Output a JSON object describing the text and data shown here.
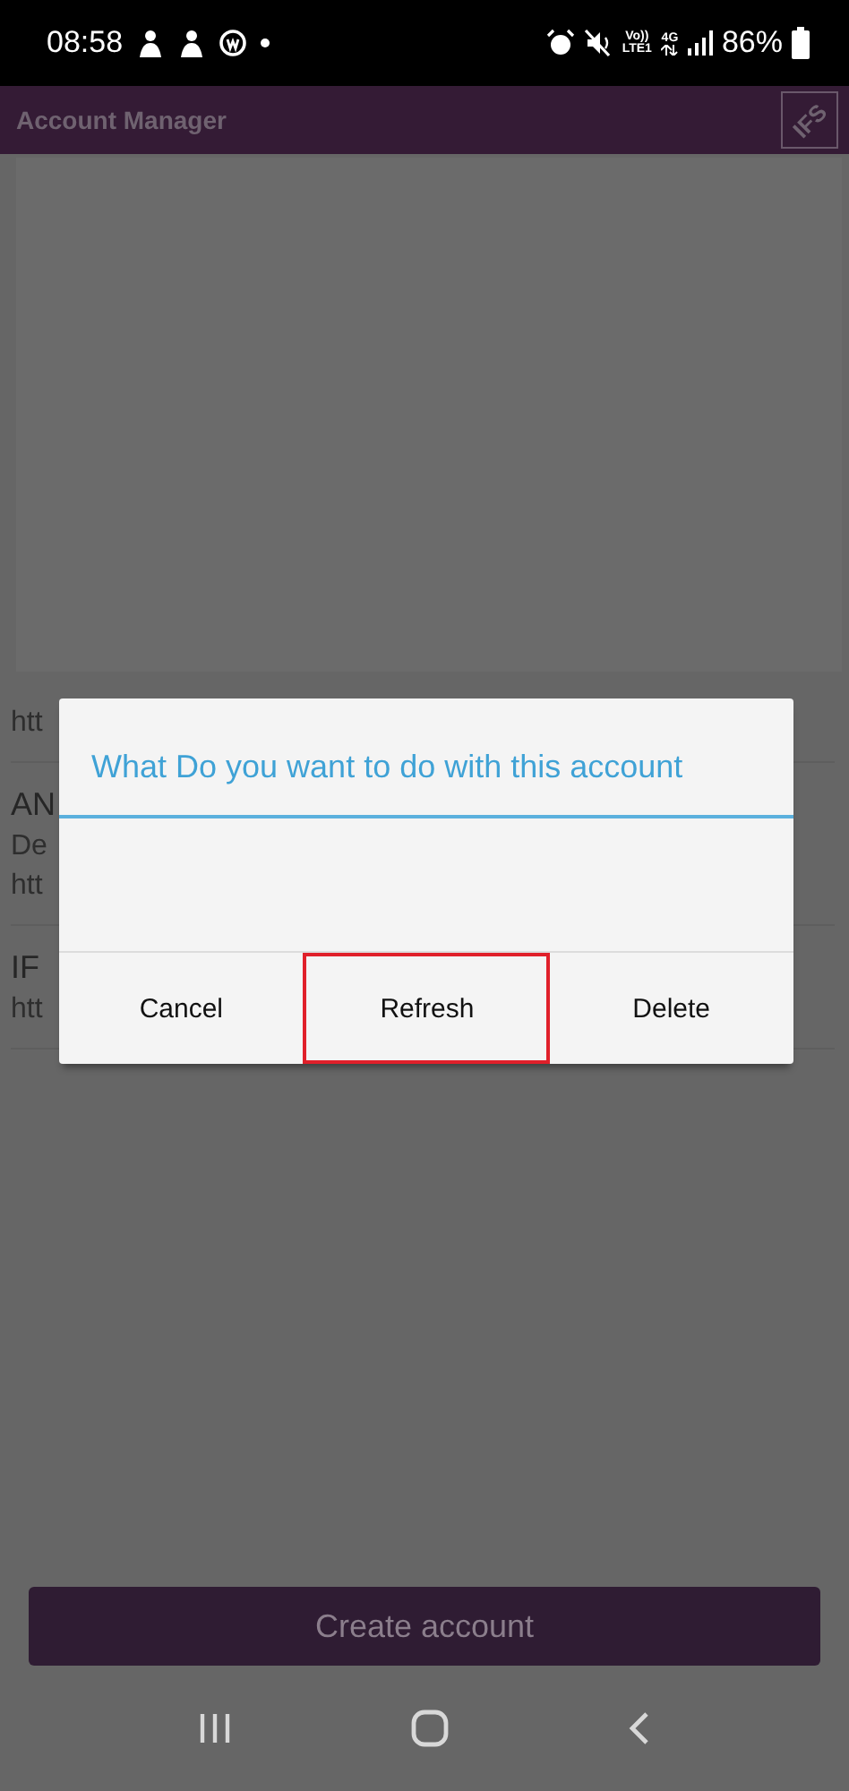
{
  "status_bar": {
    "time": "08:58",
    "network_labels": [
      "Vo))",
      "LTE1",
      "4G"
    ],
    "battery": "86%"
  },
  "app_bar": {
    "title": "Account Manager",
    "logo": "IFS"
  },
  "accounts": [
    {
      "lines": [
        "htt"
      ]
    },
    {
      "lines": [
        "AN",
        "De",
        "htt"
      ]
    },
    {
      "lines": [
        "IF",
        "htt"
      ]
    }
  ],
  "dialog": {
    "title": "What Do you want to do with this account",
    "buttons": [
      {
        "label": "Cancel",
        "highlighted": false
      },
      {
        "label": "Refresh",
        "highlighted": true
      },
      {
        "label": "Delete",
        "highlighted": false
      }
    ]
  },
  "create_button": {
    "label": "Create account"
  }
}
